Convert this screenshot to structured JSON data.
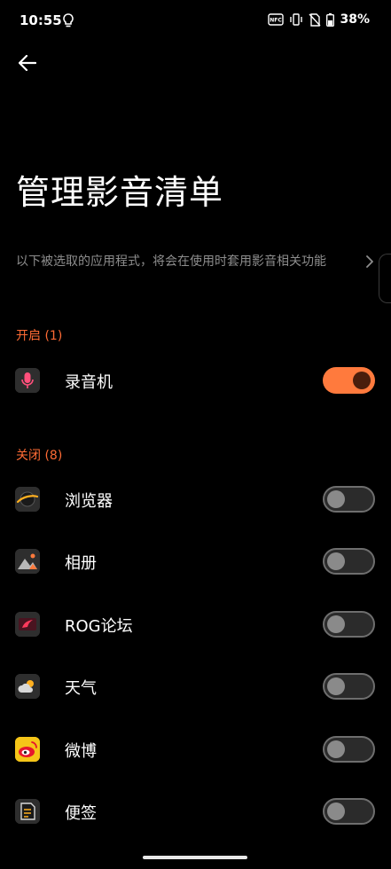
{
  "status_bar": {
    "time": "10:55",
    "battery": "38%",
    "icons": [
      "lightbulb-icon",
      "nfc-icon",
      "vibrate-icon",
      "no-sim-icon",
      "battery-icon"
    ]
  },
  "header": {
    "back_icon": "arrow-left-icon",
    "title": "管理影音清单",
    "description": "以下被选取的应用程式，将会在使用时套用影音相关功能"
  },
  "sections": {
    "enabled": {
      "label": "开启 (1)",
      "apps": [
        {
          "name": "录音机",
          "icon": "voice-recorder-icon",
          "enabled": true
        }
      ]
    },
    "disabled": {
      "label": "关闭 (8)",
      "apps": [
        {
          "name": "浏览器",
          "icon": "browser-icon",
          "enabled": false
        },
        {
          "name": "相册",
          "icon": "gallery-icon",
          "enabled": false
        },
        {
          "name": "ROG论坛",
          "icon": "rog-forum-icon",
          "enabled": false
        },
        {
          "name": "天气",
          "icon": "weather-icon",
          "enabled": false
        },
        {
          "name": "微博",
          "icon": "weibo-icon",
          "enabled": false
        },
        {
          "name": "便签",
          "icon": "notes-icon",
          "enabled": false
        }
      ]
    }
  },
  "colors": {
    "accent": "#ff6b35",
    "toggle_on": "#ff7a3d",
    "background": "#000000",
    "secondary_text": "#8d8d8d"
  }
}
